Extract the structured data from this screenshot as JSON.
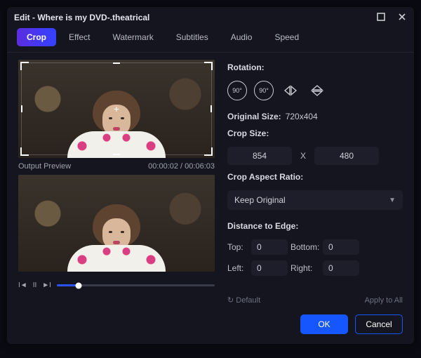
{
  "window": {
    "title": "Edit - Where is my DVD-.theatrical"
  },
  "tabs": [
    "Crop",
    "Effect",
    "Watermark",
    "Subtitles",
    "Audio",
    "Speed"
  ],
  "activeTab": 0,
  "preview": {
    "label": "Output Preview",
    "time_current": "00:00:02",
    "time_total": "00:06:03"
  },
  "rotation": {
    "label": "Rotation:"
  },
  "original": {
    "label": "Original Size:",
    "value": "720x404"
  },
  "crop": {
    "label": "Crop Size:",
    "width": "854",
    "height": "480"
  },
  "aspect": {
    "label": "Crop Aspect Ratio:",
    "selected": "Keep Original"
  },
  "edge": {
    "label": "Distance to Edge:",
    "top_label": "Top:",
    "top": "0",
    "bottom_label": "Bottom:",
    "bottom": "0",
    "left_label": "Left:",
    "left": "0",
    "right_label": "Right:",
    "right": "0"
  },
  "actions": {
    "default": "Default",
    "applyAll": "Apply to All",
    "ok": "OK",
    "cancel": "Cancel"
  },
  "timecode_sep": " / "
}
